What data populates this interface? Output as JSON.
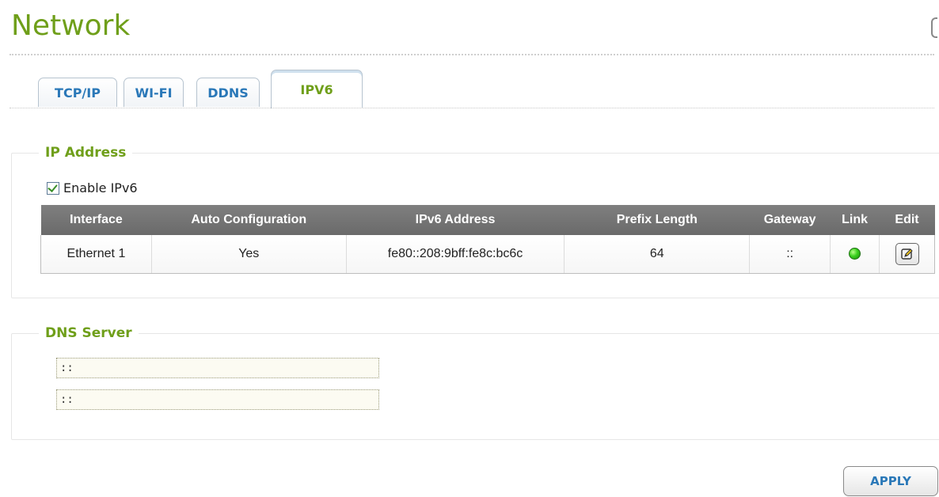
{
  "page": {
    "title": "Network"
  },
  "tabs": [
    {
      "label": "TCP/IP"
    },
    {
      "label": "WI-FI"
    },
    {
      "label": "DDNS"
    },
    {
      "label": "IPV6",
      "active": true
    }
  ],
  "ip_address": {
    "legend": "IP Address",
    "enable_ipv6_label": "Enable IPv6",
    "enable_ipv6_checked": true,
    "table": {
      "headers": [
        "Interface",
        "Auto Configuration",
        "IPv6 Address",
        "Prefix Length",
        "Gateway",
        "Link",
        "Edit"
      ],
      "rows": [
        {
          "interface": "Ethernet 1",
          "auto_configuration": "Yes",
          "ipv6_address": "fe80::208:9bff:fe8c:bc6c",
          "prefix_length": "64",
          "gateway": "::",
          "link_status": "up",
          "link_color": "#39d01e",
          "edit_icon": "edit-icon"
        }
      ]
    }
  },
  "dns_server": {
    "legend": "DNS Server",
    "inputs": [
      {
        "value": "::"
      },
      {
        "value": "::"
      }
    ]
  },
  "actions": {
    "apply_label": "APPLY"
  },
  "colors": {
    "accent_green": "#6f9f1a",
    "tab_blue": "#2a78b8",
    "table_header": "#737373"
  }
}
